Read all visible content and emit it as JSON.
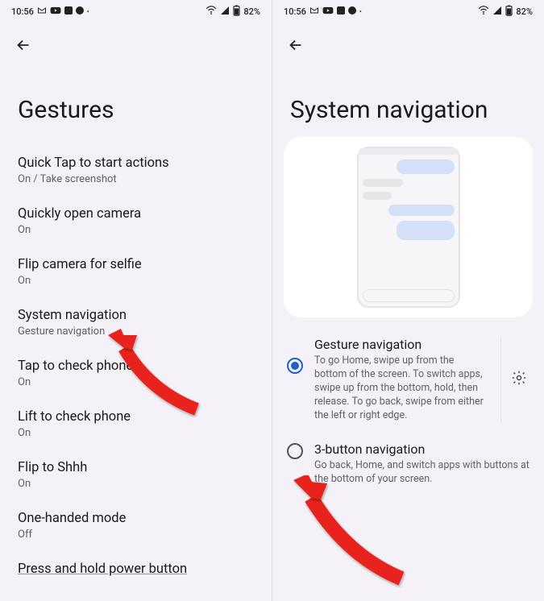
{
  "status": {
    "time": "10:56",
    "battery": "82%"
  },
  "left": {
    "title": "Gestures",
    "items": [
      {
        "title": "Quick Tap to start actions",
        "sub": "On / Take screenshot"
      },
      {
        "title": "Quickly open camera",
        "sub": "On"
      },
      {
        "title": "Flip camera for selfie",
        "sub": "On"
      },
      {
        "title": "System navigation",
        "sub": "Gesture navigation"
      },
      {
        "title": "Tap to check phone",
        "sub": "On"
      },
      {
        "title": "Lift to check phone",
        "sub": "On"
      },
      {
        "title": "Flip to Shhh",
        "sub": "On"
      },
      {
        "title": "One-handed mode",
        "sub": "Off"
      }
    ],
    "cutoff": "Press and hold power button"
  },
  "right": {
    "title": "System navigation",
    "options": [
      {
        "title": "Gesture navigation",
        "desc": "To go Home, swipe up from the bottom of the screen. To switch apps, swipe up from the bottom, hold, then release. To go back, swipe from either the left or right edge.",
        "selected": true,
        "hasGear": true
      },
      {
        "title": "3-button navigation",
        "desc": "Go back, Home, and switch apps with buttons at the bottom of your screen.",
        "selected": false,
        "hasGear": false
      }
    ]
  }
}
